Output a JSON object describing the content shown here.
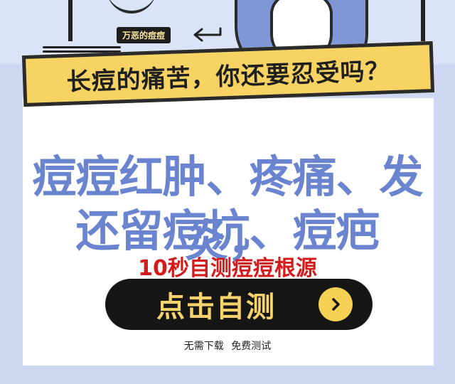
{
  "illustration": {
    "tag_label": "万恶的痘痘"
  },
  "banner": {
    "question": "长痘的痛苦，你还要忍受吗？"
  },
  "main": {
    "headline_line1": "痘痘红肿、疼痛、发炎，",
    "headline_line2": "还留痘坑、痘疤",
    "subline": "10秒自测痘痘根源",
    "cta_label": "点击自测",
    "cta_icon": "chevron-right-icon",
    "footnote_part1": "无需下载",
    "footnote_part2": "免费测试"
  },
  "colors": {
    "page_background": "#cdd9f3",
    "banner_yellow": "#f7d363",
    "headline_blue": "#6a84cf",
    "subline_red": "#d41b1b",
    "cta_background": "#161616",
    "cta_text": "#f6d36b"
  }
}
